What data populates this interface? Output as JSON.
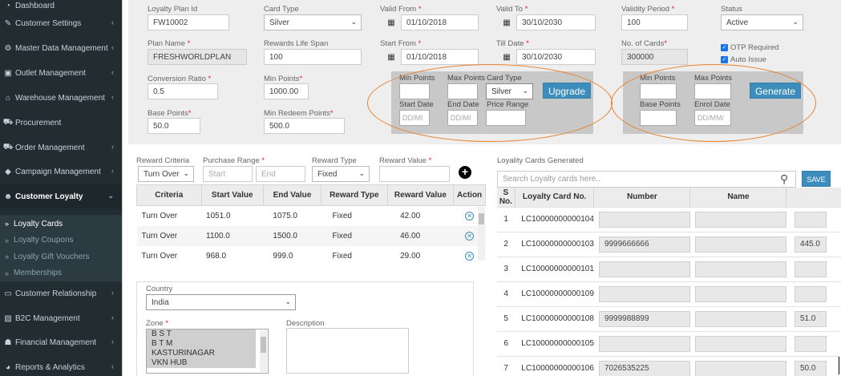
{
  "sidebar": {
    "items": [
      {
        "label": "Dashboard",
        "icon": "dashboard-icon",
        "glyph": "◔",
        "chev": ""
      },
      {
        "label": "Customer Settings",
        "icon": "wrench-icon",
        "glyph": "✎",
        "chev": "‹"
      },
      {
        "label": "Master Data Management",
        "icon": "gear-icon",
        "glyph": "⚙",
        "chev": "‹"
      },
      {
        "label": "Outlet Management",
        "icon": "store-icon",
        "glyph": "▣",
        "chev": "‹"
      },
      {
        "label": "Warehouse Management",
        "icon": "home-icon",
        "glyph": "⌂",
        "chev": "‹"
      },
      {
        "label": "Procurement",
        "icon": "cart-icon",
        "glyph": "⛟",
        "chev": ""
      },
      {
        "label": "Order Management",
        "icon": "cart-icon",
        "glyph": "⛟",
        "chev": "‹"
      },
      {
        "label": "Campaign Management",
        "icon": "tag-icon",
        "glyph": "◆",
        "chev": "‹"
      },
      {
        "label": "Customer Loyalty",
        "icon": "users-icon",
        "glyph": "☻",
        "chev": "⌄"
      }
    ],
    "sub": [
      "Loyalty Cards",
      "Loyalty Coupons",
      "Loyalty Gift Vouchers",
      "Memberships"
    ],
    "lower": [
      {
        "label": "Customer Relationship",
        "icon": "card-icon",
        "glyph": "▭",
        "chev": "‹"
      },
      {
        "label": "B2C Management",
        "icon": "image-icon",
        "glyph": "▨",
        "chev": "‹"
      },
      {
        "label": "Financial Management",
        "icon": "user-icon",
        "glyph": "☗",
        "chev": "‹"
      },
      {
        "label": "Reports & Analytics",
        "icon": "pie-icon",
        "glyph": "◕",
        "chev": "‹"
      }
    ]
  },
  "form": {
    "plan_id_label": "Loyalty Plan Id",
    "plan_id": "FW10002",
    "card_type_label": "Card Type",
    "card_type": "Silver",
    "valid_from_label": "Valid From",
    "valid_from": "01/10/2018",
    "valid_to_label": "Valid To",
    "valid_to": "30/10/2030",
    "validity_label": "Validity Period",
    "validity": "100",
    "status_label": "Status",
    "status": "Active",
    "plan_name_label": "Plan Name",
    "plan_name": "FRESHWORLDPLAN",
    "life_span_label": "Rewards Life Span",
    "life_span": "100",
    "start_from_label": "Start From",
    "start_from": "01/10/2018",
    "till_date_label": "Till Date",
    "till_date": "30/10/2030",
    "no_cards_label": "No. of Cards",
    "no_cards": "300000",
    "otp_label": "OTP Required",
    "auto_issue_label": "Auto Issue",
    "conv_label": "Conversion Ratio",
    "conv": "0.5",
    "min_points_label": "Min Points",
    "min_points": "1000.00",
    "base_points_label": "Base Points",
    "base_points": "50.0",
    "min_redeem_label": "Min Redeem Points",
    "min_redeem": "500.0"
  },
  "upgrade": {
    "min_points": "Min Points",
    "max_points": "Max Points",
    "card_type": "Card Type",
    "card_type_value": "Silver",
    "start_date": "Start Date",
    "end_date": "End Date",
    "price_range": "Price Range",
    "date_placeholder": "DD/MI",
    "button": "Upgrade"
  },
  "generate": {
    "min_points": "Min Points",
    "max_points": "Max Points",
    "base_points": "Base Points",
    "enrol_date": "Enrol Date",
    "date_placeholder": "DD/MM/",
    "button": "Generate"
  },
  "reward": {
    "criteria_label": "Reward Criteria",
    "criteria": "Turn Over",
    "range_label": "Purchase Range",
    "start_ph": "Start",
    "end_ph": "End",
    "type_label": "Reward Type",
    "type": "Fixed",
    "value_label": "Reward Value",
    "headers": [
      "Criteria",
      "Start Value",
      "End Value",
      "Reward Type",
      "Reward Value",
      "Action"
    ],
    "rows": [
      [
        "Turn Over",
        "1051.0",
        "1075.0",
        "Fixed",
        "42.00"
      ],
      [
        "Turn Over",
        "1100.0",
        "1500.0",
        "Fixed",
        "46.00"
      ],
      [
        "Turn Over",
        "968.0",
        "999.0",
        "Fixed",
        "29.00"
      ]
    ]
  },
  "location": {
    "country_label": "Country",
    "country": "India",
    "zone_label": "Zone",
    "zones": [
      "B S T",
      "B T M",
      "KASTURINAGAR",
      "VKN HUB"
    ],
    "desc_label": "Description"
  },
  "cards": {
    "title": "Loyality Cards Generated",
    "search_ph": "Search Loyalty cards here..",
    "save": "SAVE",
    "headers": [
      "S No.",
      "Loyalty Card No.",
      "Number",
      "Name"
    ],
    "rows": [
      [
        "1",
        "LC10000000000104",
        "",
        "",
        ""
      ],
      [
        "2",
        "LC10000000000103",
        "9999666666",
        "",
        "445.0"
      ],
      [
        "3",
        "LC10000000000101",
        "",
        "",
        ""
      ],
      [
        "4",
        "LC10000000000109",
        "",
        "",
        ""
      ],
      [
        "5",
        "LC10000000000108",
        "9999988899",
        "",
        "51.0"
      ],
      [
        "6",
        "LC10000000000105",
        "",
        "",
        ""
      ],
      [
        "7",
        "LC10000000000106",
        "7026535225",
        "",
        "50.0"
      ]
    ]
  }
}
